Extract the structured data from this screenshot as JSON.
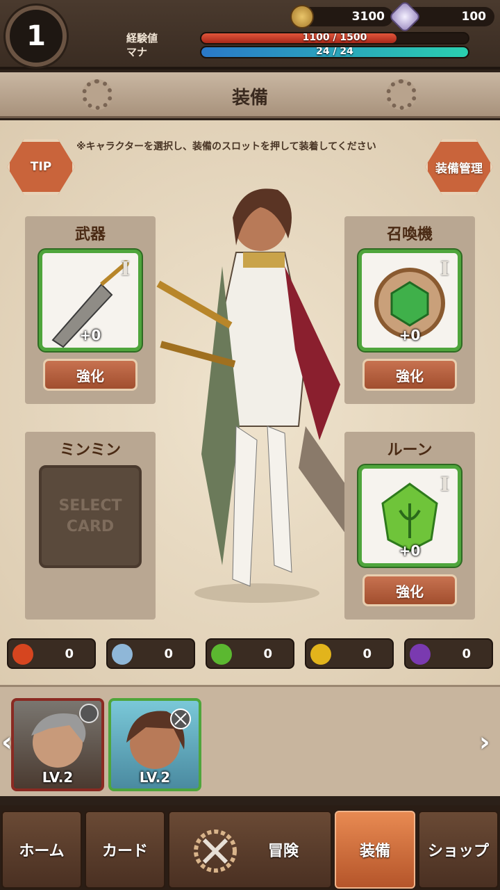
{
  "player": {
    "level": "1"
  },
  "currency": {
    "gold": "3100",
    "crystal": "100"
  },
  "stats": {
    "exp_label": "経験値",
    "exp_value": "1100 / 1500",
    "exp_fraction": 0.733,
    "mana_label": "マナ",
    "mana_value": "24 / 24",
    "mana_fraction": 1.0
  },
  "header": {
    "title": "装備"
  },
  "hint": "※キャラクターを選択し、装備のスロットを押して装着してください",
  "buttons": {
    "tip": "TIP",
    "manage": "装備管理"
  },
  "slots": {
    "weapon": {
      "title": "武器",
      "tier": "I",
      "plus": "+0",
      "enhance": "強化"
    },
    "summoner": {
      "title": "召喚機",
      "tier": "I",
      "plus": "+0",
      "enhance": "強化"
    },
    "minmin": {
      "title": "ミンミン",
      "empty_line1": "SELECT",
      "empty_line2": "CARD"
    },
    "rune": {
      "title": "ルーン",
      "tier": "I",
      "plus": "+0",
      "enhance": "強化"
    }
  },
  "gems": [
    {
      "name": "fire-gem-icon",
      "value": "0",
      "color": "#d6451f"
    },
    {
      "name": "ice-gem-icon",
      "value": "0",
      "color": "#8fb7d8"
    },
    {
      "name": "earth-gem-icon",
      "value": "0",
      "color": "#5bb830"
    },
    {
      "name": "light-gem-icon",
      "value": "0",
      "color": "#e2b41c"
    },
    {
      "name": "dark-gem-icon",
      "value": "0",
      "color": "#7a3ab0"
    }
  ],
  "roster": [
    {
      "level": "LV.2"
    },
    {
      "level": "LV.2"
    }
  ],
  "nav": {
    "home": "ホーム",
    "card": "カード",
    "adventure": "冒険",
    "equip": "装備",
    "shop": "ショップ"
  }
}
